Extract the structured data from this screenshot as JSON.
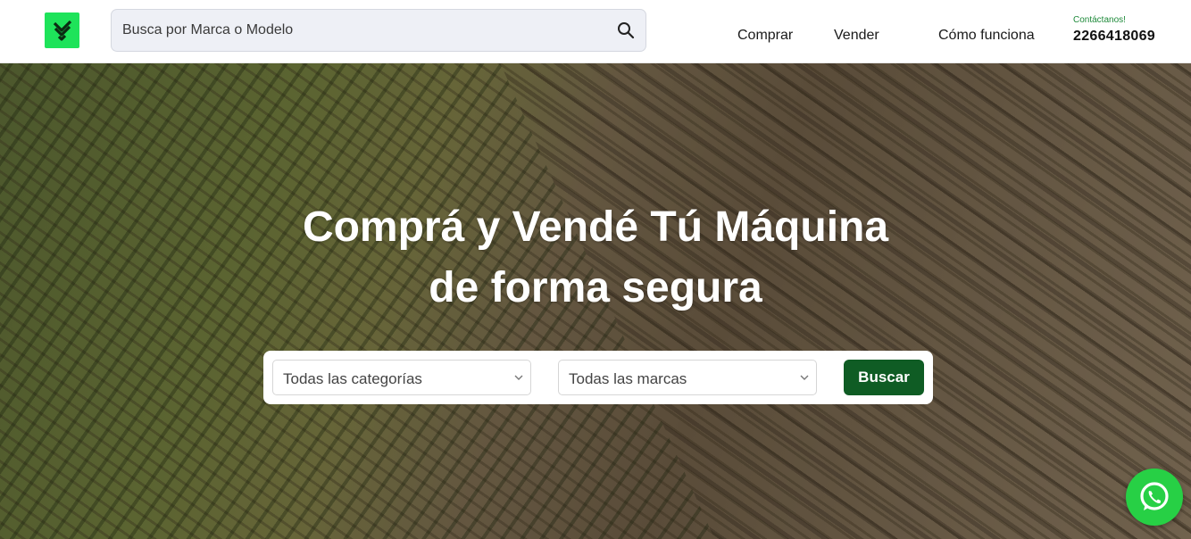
{
  "header": {
    "logo_icon": "brand-logo-icon",
    "search": {
      "placeholder": "Busca por Marca o Modelo",
      "value": "",
      "icon": "search-icon"
    },
    "nav": [
      {
        "label": "Comprar"
      },
      {
        "label": "Vender"
      },
      {
        "label": "Cómo funciona"
      }
    ],
    "contact": {
      "label": "Contáctanos!",
      "phone": "2266418069"
    }
  },
  "hero": {
    "title_line1": "Comprá y Vendé Tú Máquina",
    "title_line2": "de forma segura",
    "filters": {
      "category_selected": "Todas las categorías",
      "brand_selected": "Todas las marcas",
      "submit_label": "Buscar"
    }
  },
  "floating": {
    "whatsapp_icon": "whatsapp-icon"
  },
  "colors": {
    "brand_green": "#1ee35a",
    "button_green": "#0f5c24",
    "whatsapp_green": "#27d045"
  }
}
